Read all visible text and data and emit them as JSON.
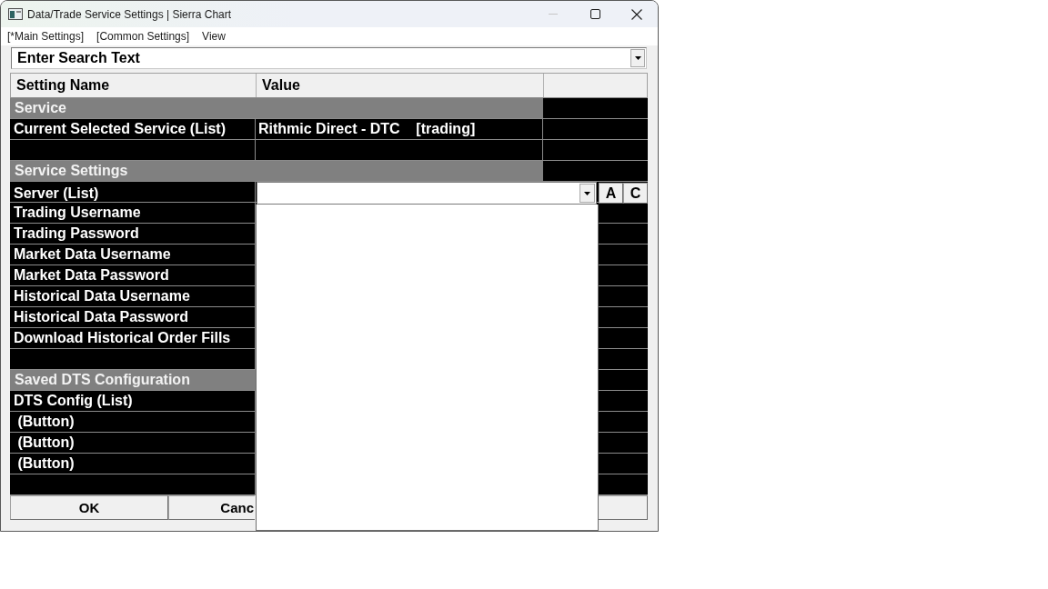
{
  "window": {
    "title": "Data/Trade Service Settings | Sierra Chart",
    "controls": [
      {
        "kind": "minimize",
        "disabled": true
      },
      {
        "kind": "maximize",
        "disabled": false
      },
      {
        "kind": "close",
        "disabled": false
      }
    ]
  },
  "menu": [
    {
      "label": "[*Main Settings]"
    },
    {
      "label": "[Common Settings]"
    },
    {
      "label": "View"
    }
  ],
  "search": {
    "placeholder": "Enter Search Text"
  },
  "table": {
    "columns": [
      "Setting Name",
      "Value"
    ],
    "rows": [
      {
        "kind": "group",
        "label": "Service"
      },
      {
        "kind": "setting",
        "name": "Current Selected Service (List)",
        "value": "Rithmic Direct - DTC    [trading]"
      },
      {
        "kind": "blank"
      },
      {
        "kind": "group",
        "label": "Service Settings"
      },
      {
        "kind": "dropdown",
        "name": "Server (List)",
        "buttons": [
          "A",
          "C"
        ]
      },
      {
        "kind": "setting",
        "name": "Trading Username"
      },
      {
        "kind": "setting",
        "name": "Trading Password"
      },
      {
        "kind": "setting",
        "name": "Market Data Username"
      },
      {
        "kind": "setting",
        "name": "Market Data Password"
      },
      {
        "kind": "setting",
        "name": "Historical Data Username"
      },
      {
        "kind": "setting",
        "name": "Historical Data Password"
      },
      {
        "kind": "setting",
        "name": "Download Historical Order Fills"
      },
      {
        "kind": "blank"
      },
      {
        "kind": "group",
        "label": "Saved DTS Configuration"
      },
      {
        "kind": "setting",
        "name": "DTS Config (List)"
      },
      {
        "kind": "setting",
        "name": " (Button)"
      },
      {
        "kind": "setting",
        "name": " (Button)"
      },
      {
        "kind": "setting",
        "name": " (Button)"
      },
      {
        "kind": "blank"
      }
    ]
  },
  "dropdown_list": {
    "expanded": true
  },
  "buttons": [
    "OK",
    "Canc"
  ]
}
